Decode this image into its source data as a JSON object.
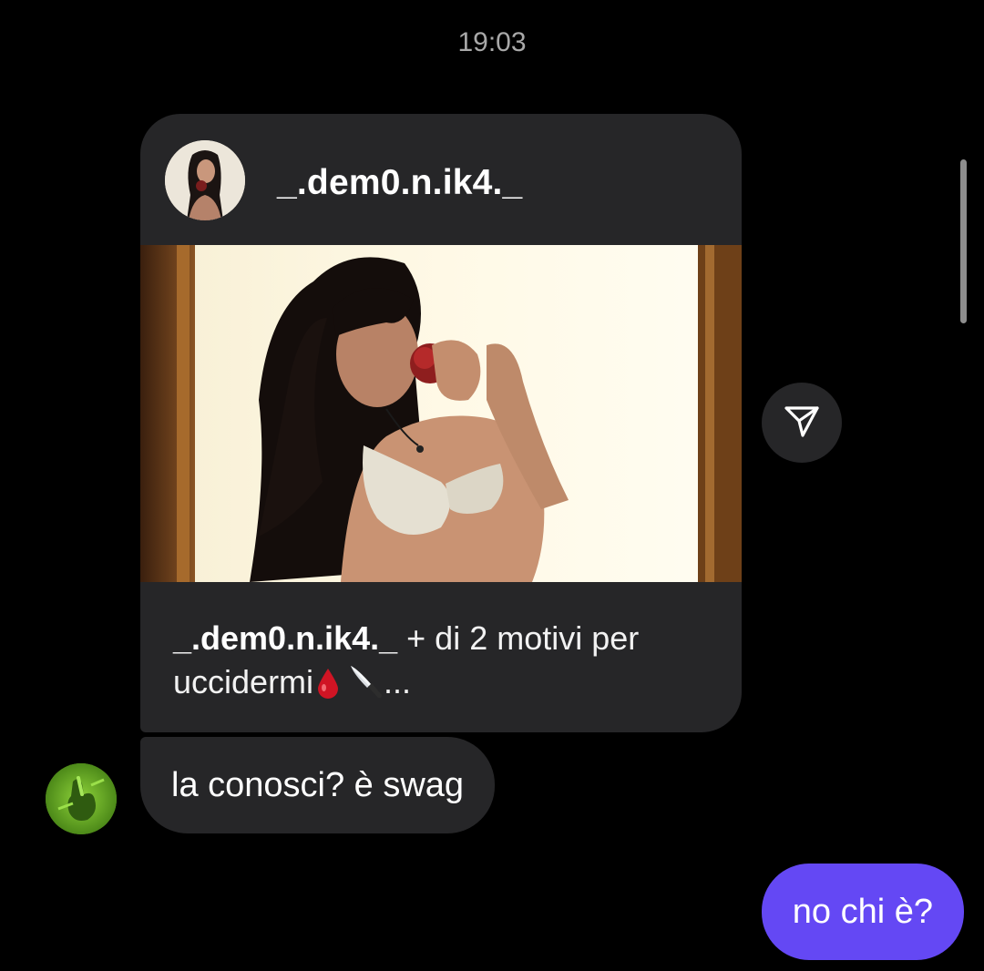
{
  "thread": {
    "timestamp": "19:03"
  },
  "shared_post": {
    "username": "_.dem0.n.ik4._",
    "caption_user": "_.dem0.n.ik4._",
    "caption_text": " + di 2 motivi per uccidermi",
    "caption_ellipsis": "...",
    "caption_emojis": [
      "drop-of-blood-icon",
      "knife-icon"
    ],
    "share_icon": "send-paper-plane-icon"
  },
  "messages": [
    {
      "direction": "received",
      "text": "la conosci? è swag",
      "avatar": "green-hand-avatar"
    },
    {
      "direction": "sent",
      "text": "no chi è?"
    }
  ],
  "colors": {
    "background": "#000000",
    "received_bubble": "#262628",
    "sent_bubble": "#6448f4",
    "timestamp_text": "#a8a8a8",
    "text": "#ffffff"
  }
}
